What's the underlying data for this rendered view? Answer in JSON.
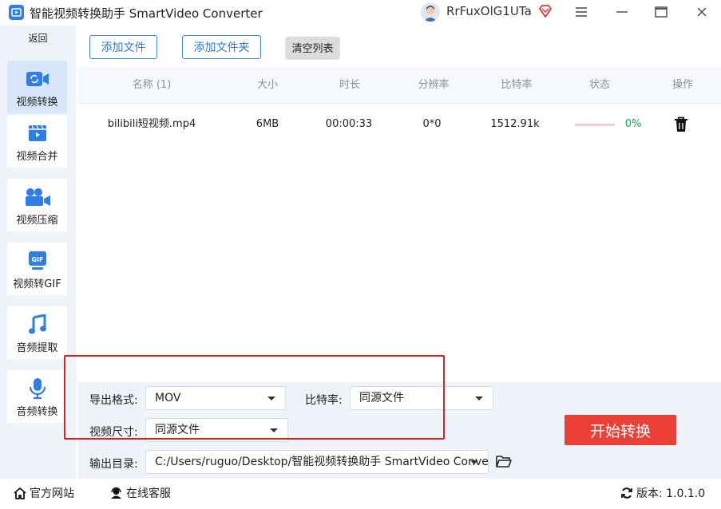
{
  "window": {
    "title": "智能视频转换助手 SmartVideo Converter",
    "user_name": "RrFuxOlG1UTa",
    "controls": [
      "menu",
      "minimize",
      "maximize",
      "close"
    ]
  },
  "sidebar": {
    "back_label": "返回",
    "items": [
      {
        "label": "视频转换",
        "icon": "video-camera-icon",
        "active": true
      },
      {
        "label": "视频合并",
        "icon": "video-merge-icon",
        "active": false
      },
      {
        "label": "视频压缩",
        "icon": "video-compress-icon",
        "active": false
      },
      {
        "label": "视频转GIF",
        "icon": "gif-icon",
        "active": false
      },
      {
        "label": "音频提取",
        "icon": "music-note-icon",
        "active": false
      },
      {
        "label": "音频转换",
        "icon": "microphone-icon",
        "active": false
      }
    ]
  },
  "toolbar": {
    "add_file": "添加文件",
    "add_folder": "添加文件夹",
    "clear_list": "清空列表"
  },
  "table": {
    "headers": [
      "名称 (1)",
      "大小",
      "时长",
      "分辨率",
      "比特率",
      "状态",
      "操作"
    ],
    "rows": [
      {
        "name": "bilibili短视频.mp4",
        "size": "6MB",
        "duration": "00:00:33",
        "resolution": "0*0",
        "bitrate": "1512.91k",
        "progress_percent": 0,
        "progress_text": "0%",
        "action_icon": "trash-icon"
      }
    ]
  },
  "settings": {
    "format_label": "导出格式:",
    "format_value": "MOV",
    "bitrate_label": "比特率:",
    "bitrate_value": "同源文件",
    "size_label": "视频尺寸:",
    "size_value": "同源文件",
    "output_label": "输出目录:",
    "output_value": "C:/Users/ruguo/Desktop/智能视频转换助手 SmartVideo Converter",
    "start_button": "开始转换"
  },
  "statusbar": {
    "website": "官方网站",
    "support": "在线客服",
    "version": "版本: 1.0.1.0"
  },
  "colors": {
    "accent_blue": "#2f78d0",
    "start_red": "#ec4037",
    "progress_green": "#1aa34a",
    "annotation_red": "#e02020"
  }
}
